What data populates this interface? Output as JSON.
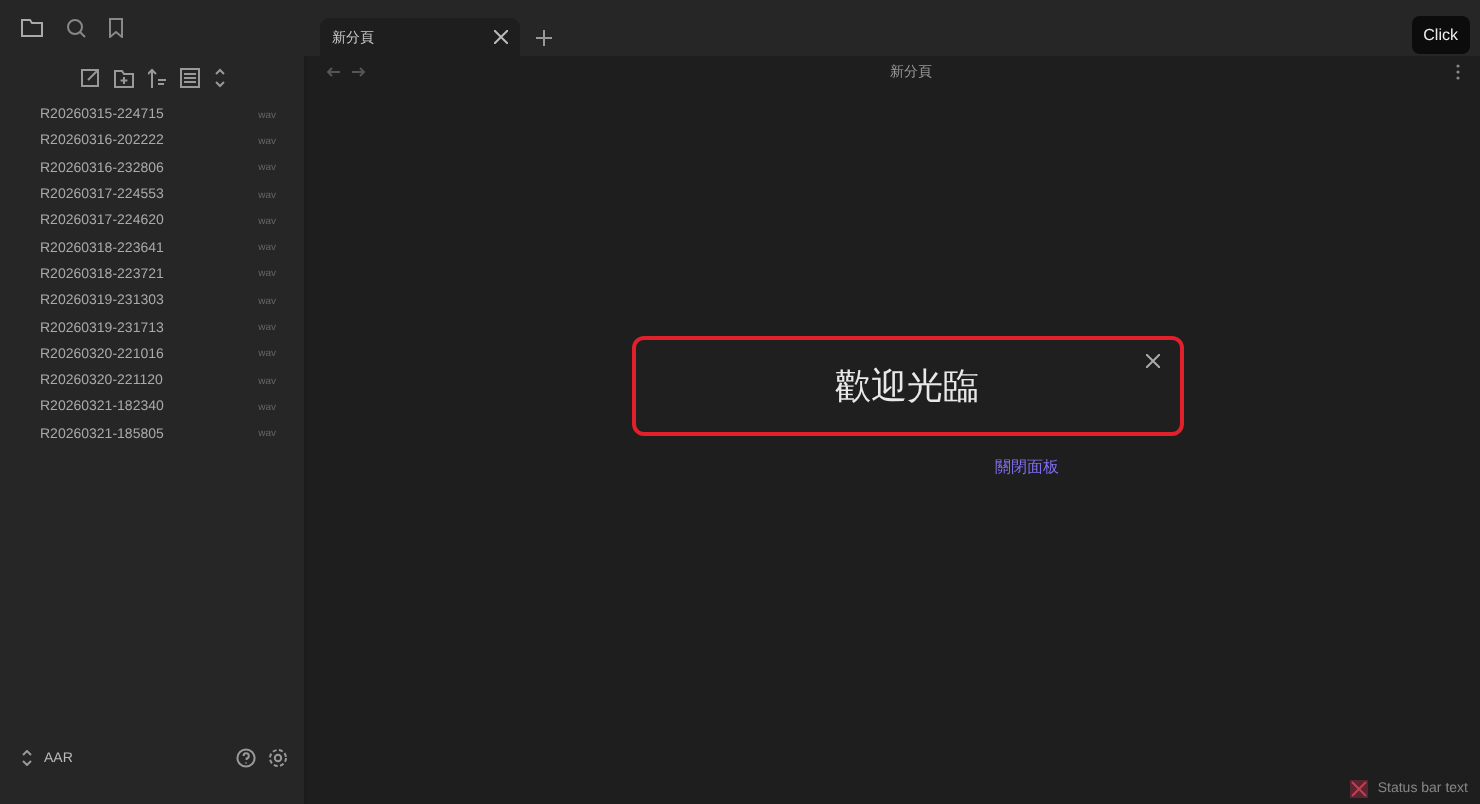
{
  "tab": {
    "title": "新分頁"
  },
  "tooltip": "Click",
  "view_header": {
    "title": "新分頁"
  },
  "files": [
    {
      "name": "R20260315-224715",
      "tag": "wav"
    },
    {
      "name": "R20260316-202222",
      "tag": "wav"
    },
    {
      "name": "R20260316-232806",
      "tag": "wav"
    },
    {
      "name": "R20260317-224553",
      "tag": "wav"
    },
    {
      "name": "R20260317-224620",
      "tag": "wav"
    },
    {
      "name": "R20260318-223641",
      "tag": "wav"
    },
    {
      "name": "R20260318-223721",
      "tag": "wav"
    },
    {
      "name": "R20260319-231303",
      "tag": "wav"
    },
    {
      "name": "R20260319-231713",
      "tag": "wav"
    },
    {
      "name": "R20260320-221016",
      "tag": "wav"
    },
    {
      "name": "R20260320-221120",
      "tag": "wav"
    },
    {
      "name": "R20260321-182340",
      "tag": "wav"
    },
    {
      "name": "R20260321-185805",
      "tag": "wav"
    }
  ],
  "vault": "AAR",
  "modal": {
    "title": "歡迎光臨"
  },
  "close_link": "關閉面板",
  "status_bar": "Status bar text"
}
